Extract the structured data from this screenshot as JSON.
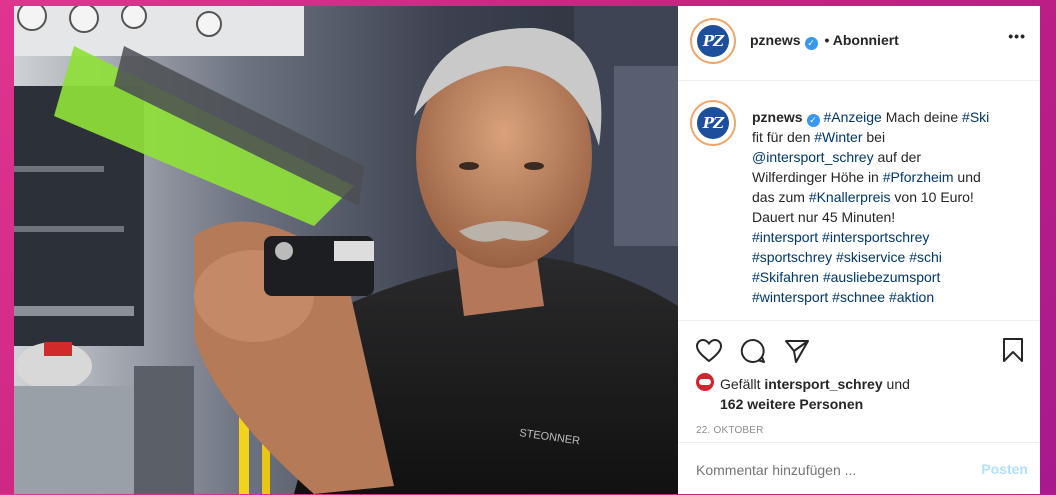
{
  "post": {
    "author": "pznews",
    "avatar_text": "PZ",
    "follow_status": "• Abonniert",
    "more_label": "•••",
    "caption": {
      "author": "pznews",
      "line1": [
        {
          "t": "#Anzeige",
          "tag": true
        },
        {
          "t": " Mach deine ",
          "tag": false
        },
        {
          "t": "#Ski",
          "tag": true
        }
      ],
      "line2": [
        {
          "t": "fit für den ",
          "tag": false
        },
        {
          "t": "#Winter",
          "tag": true
        },
        {
          "t": " bei",
          "tag": false
        }
      ],
      "line3": [
        {
          "t": "@intersport_schrey",
          "tag": true
        },
        {
          "t": " auf der",
          "tag": false
        }
      ],
      "line4": [
        {
          "t": "Wilferdinger Höhe in ",
          "tag": false
        },
        {
          "t": "#Pforzheim",
          "tag": true
        },
        {
          "t": " und",
          "tag": false
        }
      ],
      "line5": [
        {
          "t": "das zum ",
          "tag": false
        },
        {
          "t": "#Knallerpreis",
          "tag": true
        },
        {
          "t": " von 10 Euro!",
          "tag": false
        }
      ],
      "line6": [
        {
          "t": "Dauert nur 45 Minuten!",
          "tag": false
        }
      ],
      "line7": [
        {
          "t": "#intersport",
          "tag": true
        },
        {
          "t": " ",
          "tag": false
        },
        {
          "t": "#intersportschrey",
          "tag": true
        }
      ],
      "line8": [
        {
          "t": "#sportschrey",
          "tag": true
        },
        {
          "t": " ",
          "tag": false
        },
        {
          "t": "#skiservice",
          "tag": true
        },
        {
          "t": " ",
          "tag": false
        },
        {
          "t": "#schi",
          "tag": true
        }
      ],
      "line9": [
        {
          "t": "#Skifahren",
          "tag": true
        },
        {
          "t": " ",
          "tag": false
        },
        {
          "t": "#ausliebezumsport",
          "tag": true
        }
      ],
      "line10": [
        {
          "t": "#wintersport",
          "tag": true
        },
        {
          "t": " ",
          "tag": false
        },
        {
          "t": "#schnee",
          "tag": true
        },
        {
          "t": " ",
          "tag": false
        },
        {
          "t": "#aktion",
          "tag": true
        }
      ]
    },
    "likes": {
      "prefix": "Gefällt ",
      "liker": "intersport_schrey",
      "middle": " und",
      "others": "162 weitere Personen"
    },
    "date": "22. OKTOBER",
    "comment_placeholder": "Kommentar hinzufügen ...",
    "post_button": "Posten",
    "photo_badge_text": "STEONNER"
  },
  "colors": {
    "accent_blue": "#3897f0",
    "hashtag": "#00376b",
    "post_button_disabled": "#b2dffc",
    "background_pink": "#d52f8a",
    "ski_green": "#8fe03a"
  },
  "icons": [
    "heart-icon",
    "comment-icon",
    "share-icon",
    "bookmark-icon",
    "verified-badge-icon",
    "more-options-icon"
  ]
}
